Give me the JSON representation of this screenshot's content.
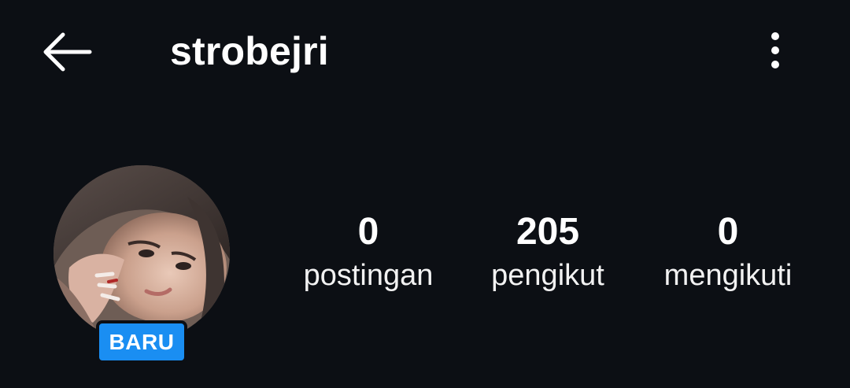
{
  "header": {
    "username": "strobejri",
    "back_icon": "arrow-left-icon",
    "more_icon": "more-vertical-icon"
  },
  "profile": {
    "badge": "BARU",
    "badge_color": "#1a8ef2"
  },
  "stats": [
    {
      "value": "0",
      "label": "postingan"
    },
    {
      "value": "205",
      "label": "pengikut"
    },
    {
      "value": "0",
      "label": "mengikuti"
    }
  ],
  "colors": {
    "background": "#0c0f14",
    "text": "#ffffff"
  }
}
